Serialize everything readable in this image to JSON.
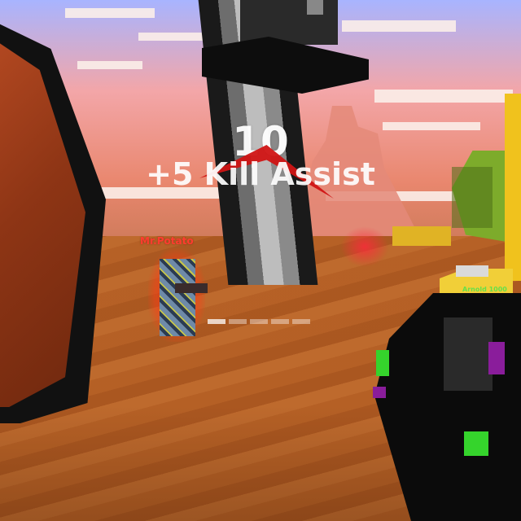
{
  "hud": {
    "score_popup": "10",
    "reward_text": "+5 Kill Assist",
    "crosshair_segments": 5
  },
  "players": {
    "enemy_name": "Mr.Potato",
    "ally_name": "Arnold 1000"
  },
  "colors": {
    "enemy_name_color": "#ff3b2f",
    "ally_name_color": "#66e04a",
    "chevron_color": "#d01414"
  }
}
